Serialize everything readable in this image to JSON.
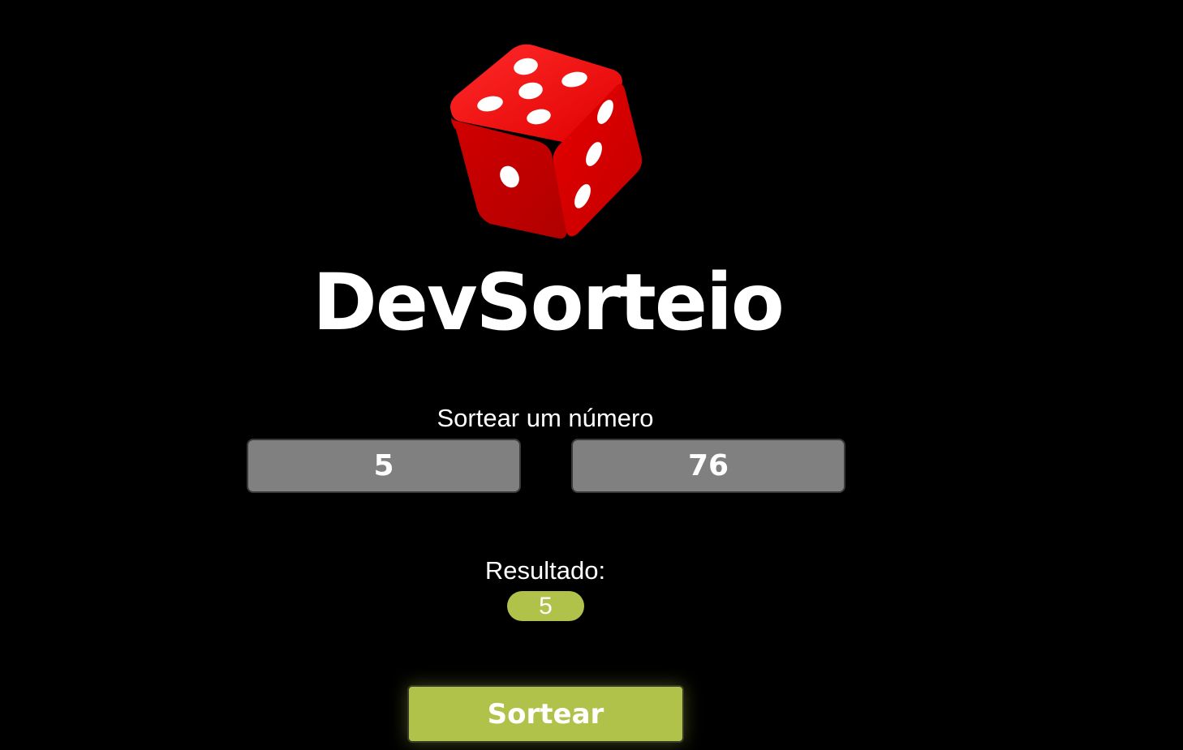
{
  "app": {
    "title": "DevSorteio",
    "logo_icon": "dice-icon"
  },
  "form": {
    "subtitle": "Sortear um número",
    "min_value": "5",
    "max_value": "76"
  },
  "result": {
    "label": "Resultado:",
    "value": "5"
  },
  "actions": {
    "draw_label": "Sortear"
  },
  "colors": {
    "background": "#000000",
    "accent": "#b0c24a",
    "input_bg": "#808080",
    "dice_red": "#e10f14"
  }
}
